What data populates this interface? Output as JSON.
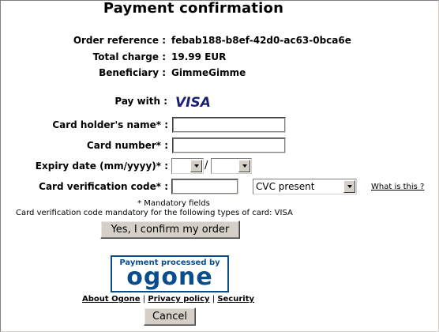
{
  "page": {
    "title": "Payment confirmation"
  },
  "order": {
    "reference_label": "Order reference :",
    "reference_value": "febab188-b8ef-42d0-ac63-0bca6e",
    "charge_label": "Total charge :",
    "charge_value": "19.99 EUR",
    "beneficiary_label": "Beneficiary :",
    "beneficiary_value": "GimmeGimme"
  },
  "payment": {
    "pay_with_label": "Pay with :",
    "card_brand": "VISA",
    "card_brand_color": "#1a1f71"
  },
  "form": {
    "holder_label": "Card holder's name* :",
    "holder_value": "",
    "number_label": "Card number* :",
    "number_value": "",
    "expiry_label": "Expiry date (mm/yyyy)* :",
    "expiry_month_value": "",
    "expiry_separator": "/",
    "expiry_year_value": "",
    "cvc_label": "Card verification code* :",
    "cvc_value": "",
    "cvc_select_value": "CVC present",
    "what_is_this": "What is this ?"
  },
  "notes": {
    "mandatory": "* Mandatory fields",
    "cvc_note": "Card verification code mandatory for the following types of card: VISA"
  },
  "buttons": {
    "confirm": "Yes, I confirm my order",
    "cancel": "Cancel"
  },
  "ogone": {
    "caption": "Payment processed by",
    "wordmark": "ogone",
    "brand_color": "#0b4d8c"
  },
  "footer_links": {
    "about": "About Ogone",
    "privacy": "Privacy policy",
    "security": "Security",
    "separator": "|"
  }
}
